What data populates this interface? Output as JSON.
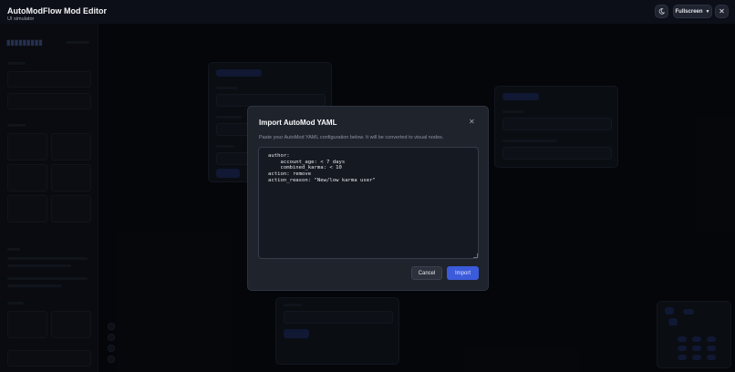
{
  "header": {
    "title": "AutoModFlow Mod Editor",
    "subtitle": "UI simulator",
    "theme_icon": "moon-icon",
    "fullscreen_label": "Fullscreen",
    "close_icon": "close-icon"
  },
  "modal": {
    "title": "Import AutoMod YAML",
    "description": "Paste your AutoMod YAML configuration below. It will be converted to visual nodes.",
    "yaml_value": "author:\n    account_age: < 7 days\n    combined_karma: < 10\naction: remove\naction_reason: \"New/low karma user\"",
    "cancel_label": "Cancel",
    "import_label": "Import"
  },
  "colors": {
    "accent": "#3b5bdb",
    "modal_bg": "#1f232c",
    "page_bg": "#0a0d14"
  }
}
